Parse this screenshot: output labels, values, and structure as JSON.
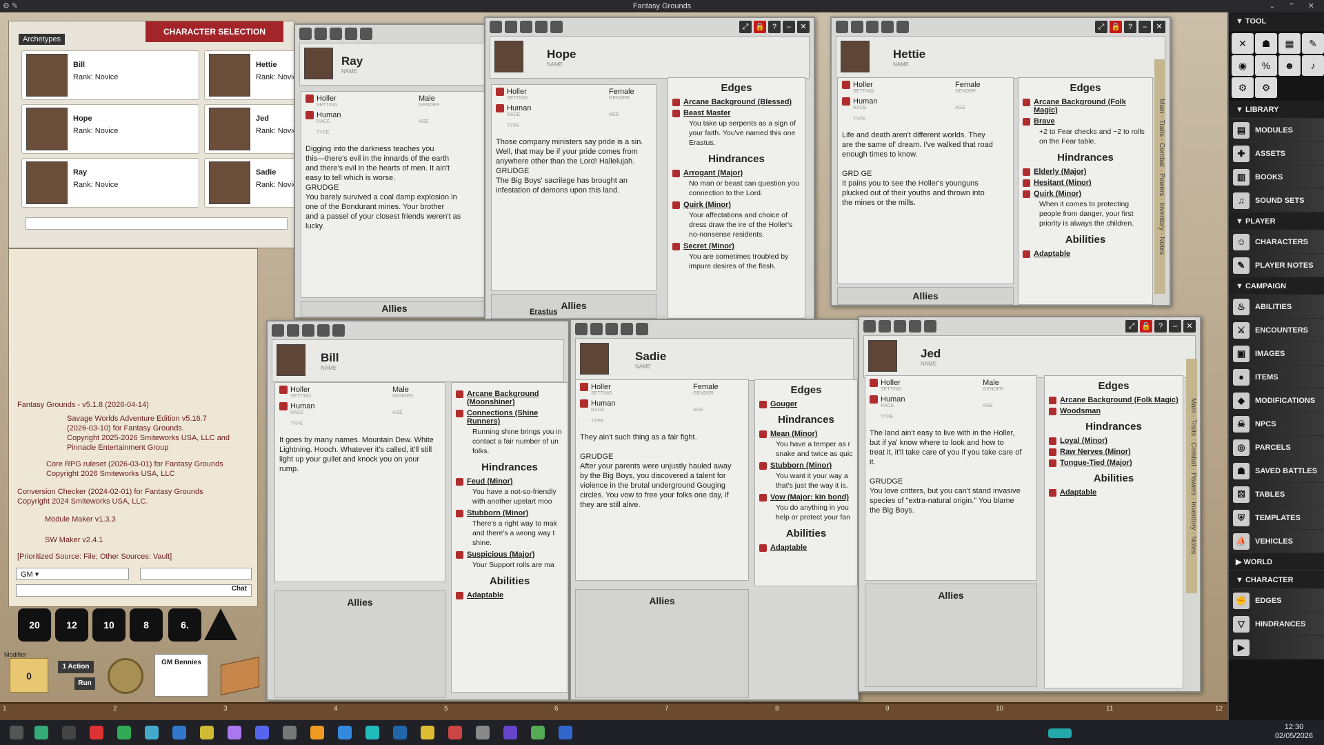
{
  "app": {
    "title": "Fantasy Grounds"
  },
  "charsel": {
    "title": "CHARACTER SELECTION",
    "tab": "Archetypes",
    "rank": "Rank: Novice",
    "cards": [
      {
        "name": "Bill"
      },
      {
        "name": "Hettie"
      },
      {
        "name": "Hope"
      },
      {
        "name": "Jed"
      },
      {
        "name": "Ray"
      },
      {
        "name": "Sadie"
      }
    ]
  },
  "chat": {
    "lines": [
      "Fantasy Grounds - v5.1.8 (2026-04-14)",
      "Savage Worlds Adventure Edition v5.16.7",
      "(2026-03-10) for Fantasy Grounds.",
      "Copyright 2025-2026 Smiteworks USA, LLC and",
      "Pinnacle Entertainment Group",
      "Core RPG ruleset (2026-03-01) for Fantasy Grounds",
      "Copyright 2026 Smiteworks USA, LLC",
      "Conversion Checker (2024-02-01) for Fantasy Grounds",
      "Copyright 2024 Smiteworks USA, LLC.",
      "Module Maker v1.3.3",
      "SW Maker v2.4.1",
      "[Prioritized Source: File; Other Sources: Vault]"
    ],
    "identity": "GM",
    "chat_label": "Chat"
  },
  "dice": [
    "20",
    "12",
    "10",
    "8",
    "6.",
    ""
  ],
  "controls": {
    "modifier_label": "Modifier",
    "modifier_value": "0",
    "action": "1 Action",
    "run": "Run",
    "gm_bennies": "GM Bennies"
  },
  "labels": {
    "setting": "SETTING",
    "race": "RACE",
    "gender": "GENDER",
    "age": "AGE",
    "type": "TYPE",
    "name": "NAME",
    "edges": "Edges",
    "hindrances": "Hindrances",
    "abilities": "Abilities",
    "allies": "Allies",
    "grudge": "GRUDGE"
  },
  "sheets": {
    "ray": {
      "name": "Ray",
      "setting": "Holler",
      "race": "Human",
      "gender": "Male",
      "bio": [
        "Digging into the darkness teaches you",
        "this—there's evil in the innards of the earth",
        "and there's evil in the hearts of men. It ain't",
        "easy to tell which is worse.",
        "GRUDGE",
        "You barely survived a coal damp explosion in",
        "one of the Bondurant mines. Your brother",
        "and a passel of your closest friends weren't as",
        "lucky."
      ]
    },
    "hope": {
      "name": "Hope",
      "setting": "Holler",
      "race": "Human",
      "gender": "Female",
      "bio": [
        "Those company ministers say pride is a sin.",
        "Well, that may be if your pride comes from",
        "anywhere other than the Lord! Hallelujah.",
        "GRUDGE",
        "The Big Boys' sacrilege has brought an",
        "infestation of demons upon this land."
      ],
      "edges": [
        {
          "n": "Arcane Background (Blessed)",
          "d": ""
        },
        {
          "n": "Beast Master",
          "d": "You take up serpents as a sign of your faith. You've named this one Erastus."
        }
      ],
      "hind": [
        {
          "n": "Arrogant (Major)",
          "d": "No man or beast can question you connection to the Lord."
        },
        {
          "n": "Quirk (Minor)",
          "d": "Your affectations and choice of dress draw the ire of the Holler's no-nonsense residents."
        },
        {
          "n": "Secret (Minor)",
          "d": "You are sometimes troubled by impure desires of the flesh."
        }
      ],
      "ally": "Erastus"
    },
    "hettie": {
      "name": "Hettie",
      "setting": "Holler",
      "race": "Human",
      "gender": "Female",
      "bio": [
        "Life and death aren't different worlds. They",
        "are the same ol' dream. I've walked that road",
        "enough times to know.",
        "GRD GE",
        "It pains you to see the Holler's younguns",
        "plucked out of their youths and thrown into",
        "the mines or the mills."
      ],
      "edges": [
        {
          "n": "Arcane Background (Folk Magic)",
          "d": ""
        },
        {
          "n": "Brave",
          "d": "+2 to Fear checks and −2 to rolls on the Fear table."
        }
      ],
      "hind": [
        {
          "n": "Elderly (Major)",
          "d": ""
        },
        {
          "n": "Hesitant (Minor)",
          "d": ""
        },
        {
          "n": "Quirk (Minor)",
          "d": "When it comes to protecting people from danger, your first priority is always the children."
        }
      ],
      "abil": [
        "Adaptable"
      ]
    },
    "bill": {
      "name": "Bill",
      "setting": "Holler",
      "race": "Human",
      "gender": "Male",
      "bio": [
        "It goes by many names. Mountain Dew. White",
        "Lightning. Hooch. Whatever it's called, it'll still",
        "light up your gullet and knock you on your",
        "rump."
      ],
      "edges": [
        {
          "n": "Arcane Background (Moonshiner)",
          "d": ""
        },
        {
          "n": "Connections (Shine Runners)",
          "d": "Running shine brings you in contact a fair number of un folks."
        }
      ],
      "hind": [
        {
          "n": "Feud (Minor)",
          "d": "You have a not-so-friendly with another upstart moo"
        },
        {
          "n": "Stubborn (Minor)",
          "d": "There's a right way to mak and there's a wrong way t shine."
        },
        {
          "n": "Suspicious (Major)",
          "d": "Your Support rolls are ma"
        }
      ],
      "abil": [
        "Adaptable"
      ]
    },
    "sadie": {
      "name": "Sadie",
      "setting": "Holler",
      "race": "Human",
      "gender": "Female",
      "bio": [
        "They ain't such thing as a fair fight.",
        "",
        "GRUDGE",
        "After your parents were unjustly hauled away",
        "by the Big Boys, you discovered a talent for",
        "violence in the brutal underground Gouging",
        "circles. You vow to free your folks one day, if",
        "they are still alive."
      ],
      "edges": [
        {
          "n": "Gouger",
          "d": ""
        }
      ],
      "hind": [
        {
          "n": "Mean (Minor)",
          "d": "You have a temper as r snake and twice as quic"
        },
        {
          "n": "Stubborn (Minor)",
          "d": "You want it your way a that's just the way it is."
        },
        {
          "n": "Vow (Major: kin bond)",
          "d": "You do anything in you help or protect your fan"
        }
      ],
      "abil": [
        "Adaptable"
      ]
    },
    "jed": {
      "name": "Jed",
      "setting": "Holler",
      "race": "Human",
      "gender": "Male",
      "bio": [
        "The land ain't easy to live with in the Holler,",
        "but if ya' know where to look and how to",
        "treat it, it'll take care of you if you take care of",
        "it.",
        "",
        "GRUDGE",
        "You love critters, but you can't stand invasive",
        "species of \"extra-natural origin.\" You blame",
        "the Big Boys."
      ],
      "edges": [
        {
          "n": "Arcane Background (Folk Magic)",
          "d": ""
        },
        {
          "n": "Woodsman",
          "d": ""
        }
      ],
      "hind": [
        {
          "n": "Loyal (Minor)",
          "d": ""
        },
        {
          "n": "Raw Nerves (Minor)",
          "d": ""
        },
        {
          "n": "Tongue-Tied (Major)",
          "d": ""
        }
      ],
      "abil": [
        "Adaptable"
      ]
    }
  },
  "sidetabs": [
    "Main",
    "Traits",
    "Combat",
    "Powers",
    "Inventory",
    "Notes"
  ],
  "sidebar": {
    "tool": "TOOL",
    "library": "LIBRARY",
    "player": "PLAYER",
    "campaign": "CAMPAIGN",
    "world": "WORLD",
    "character": "CHARACTER",
    "library_items": [
      "MODULES",
      "ASSETS",
      "BOOKS",
      "SOUND SETS"
    ],
    "player_items": [
      "CHARACTERS",
      "PLAYER NOTES"
    ],
    "campaign_items": [
      "ABILITIES",
      "ENCOUNTERS",
      "IMAGES",
      "ITEMS",
      "MODIFICATIONS",
      "NPCS",
      "PARCELS",
      "SAVED BATTLES",
      "TABLES",
      "TEMPLATES",
      "VEHICLES"
    ],
    "character_items": [
      "EDGES",
      "HINDRANCES"
    ]
  },
  "ruler": [
    "1",
    "2",
    "3",
    "4",
    "5",
    "6",
    "7",
    "8",
    "9",
    "10",
    "11",
    "12"
  ],
  "clock": {
    "time": "12:30",
    "date": "02/05/2026"
  }
}
